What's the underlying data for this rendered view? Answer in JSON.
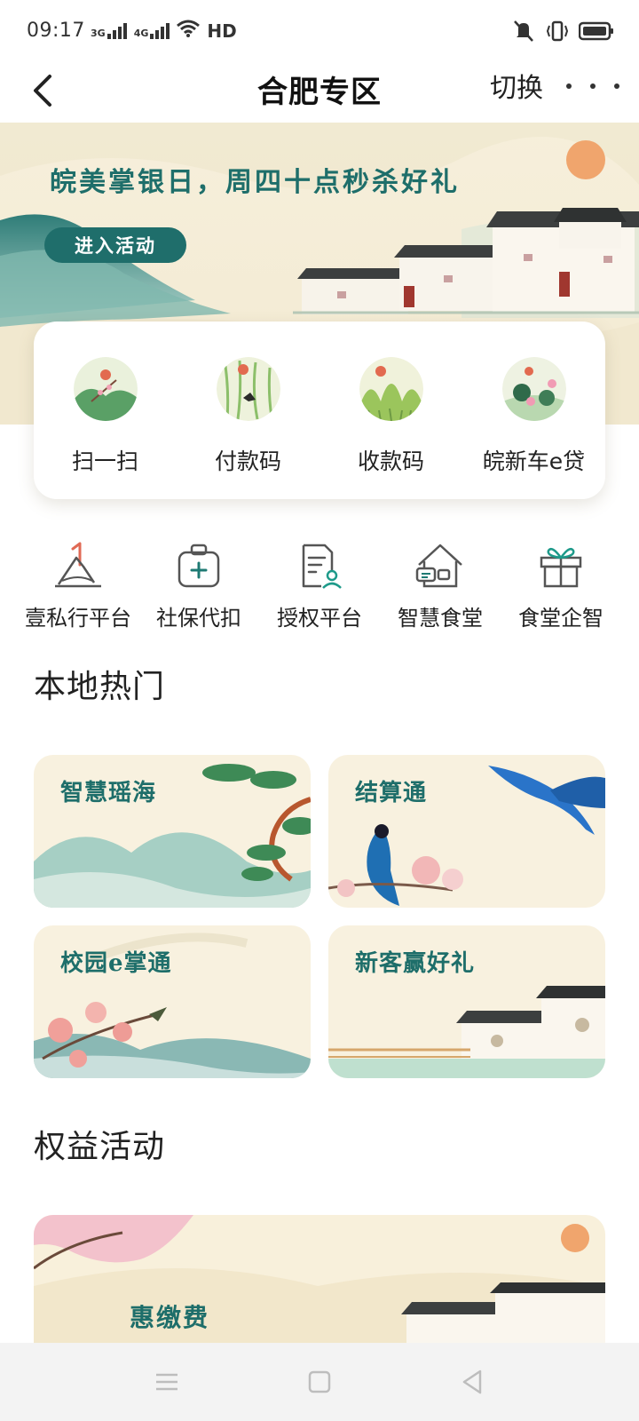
{
  "status_bar": {
    "time": "09:17",
    "signal1": "3G",
    "signal2": "4G",
    "hd": "HD"
  },
  "nav": {
    "title": "合肥专区",
    "switch_label": "切换"
  },
  "banner": {
    "title": "皖美掌银日，周四十点秒杀好礼",
    "button_label": "进入活动"
  },
  "quick_actions": [
    {
      "label": "扫一扫"
    },
    {
      "label": "付款码"
    },
    {
      "label": "收款码"
    },
    {
      "label": "皖新车e贷"
    }
  ],
  "services": [
    {
      "label": "壹私行平台",
      "icon": "private-bank-icon"
    },
    {
      "label": "社保代扣",
      "icon": "medical-kit-icon"
    },
    {
      "label": "授权平台",
      "icon": "document-user-icon"
    },
    {
      "label": "智慧食堂",
      "icon": "house-chat-icon"
    },
    {
      "label": "食堂企智",
      "icon": "gift-icon"
    }
  ],
  "sections": {
    "local_hot": "本地热门",
    "benefits": "权益活动"
  },
  "tiles": [
    {
      "label": "智慧瑶海"
    },
    {
      "label": "结算通"
    },
    {
      "label": "校园e掌通"
    },
    {
      "label": "新客赢好礼"
    }
  ],
  "promo": {
    "label": "惠缴费"
  },
  "colors": {
    "accent": "#1e6e6a",
    "banner_bg": "#f7f0dc",
    "tile_bg": "#f8f1df"
  }
}
